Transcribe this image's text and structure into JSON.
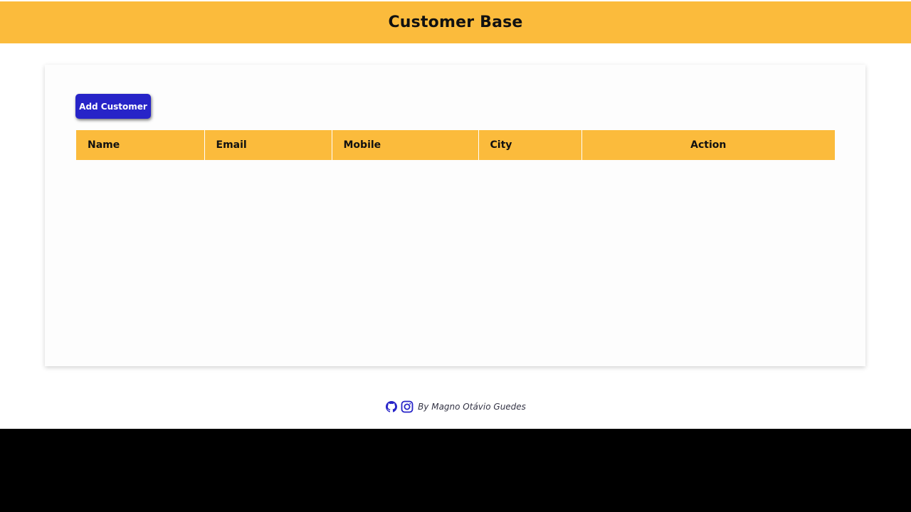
{
  "header": {
    "title": "Customer Base"
  },
  "toolbar": {
    "add_label": "Add Customer"
  },
  "table": {
    "columns": [
      "Name",
      "Email",
      "Mobile",
      "City",
      "Action"
    ],
    "rows": []
  },
  "footer": {
    "credit": "By Magno Otávio Guedes",
    "icons": [
      "github-icon",
      "instagram-icon"
    ]
  },
  "colors": {
    "accent": "#fbbb3c",
    "button": "#2724c8",
    "background": "#ffffff"
  }
}
